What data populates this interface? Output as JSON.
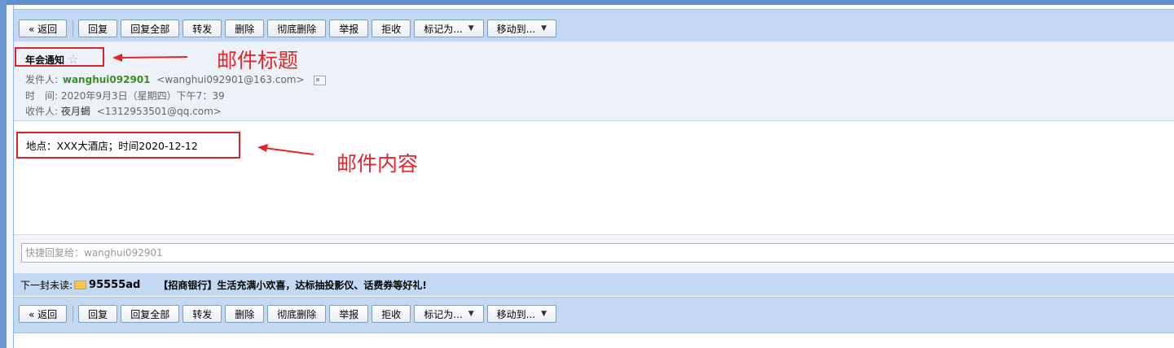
{
  "toolbar": {
    "back": "« 返回",
    "reply": "回复",
    "reply_all": "回复全部",
    "forward": "转发",
    "delete": "删除",
    "delete_permanent": "彻底删除",
    "report": "举报",
    "reject": "拒收",
    "mark_as": "标记为...",
    "move_to": "移动到..."
  },
  "email": {
    "subject": "年会通知",
    "from_label": "发件人:",
    "from_name": "wanghui092901",
    "from_addr": "<wanghui092901@163.com>",
    "time_label": "时　间:",
    "time_value": "2020年9月3日（星期四）下午7：39",
    "to_label": "收件人:",
    "to_name": "夜月蝎",
    "to_addr": "<1312953501@qq.com>",
    "body": "地点：XXX大酒店；时间2020-12-12"
  },
  "quick_reply": {
    "placeholder": "快捷回复给：wanghui092901"
  },
  "next_unread": {
    "label": "下一封未读:",
    "from": "95555ad",
    "subject": "【招商银行】生活充满小欢喜，达标抽投影仪、话费券等好礼!"
  },
  "annotations": {
    "subject_label": "邮件标题",
    "body_label": "邮件内容",
    "color": "#e3262a"
  },
  "icons": {
    "star": "star-outline-icon",
    "card": "contact-card-icon",
    "envelope": "envelope-icon",
    "dropdown": "caret-down-icon"
  }
}
